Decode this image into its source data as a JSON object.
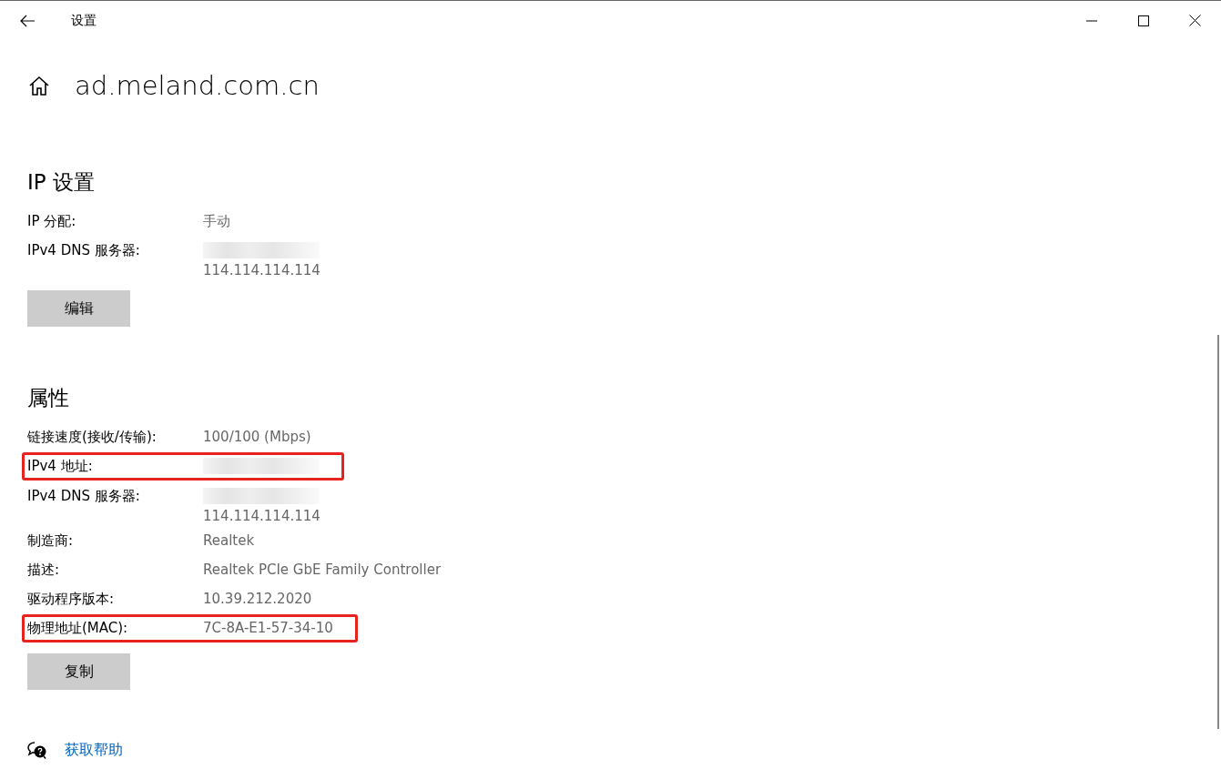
{
  "window": {
    "title": "设置"
  },
  "page_title": "ad.meland.com.cn",
  "sections": [
    {
      "title": "IP 设置",
      "rows": [
        {
          "label": "IP 分配:",
          "highlighted": false,
          "values": [
            {
              "kind": "text",
              "text": "手动"
            }
          ]
        },
        {
          "label": "IPv4 DNS 服务器:",
          "highlighted": false,
          "values": [
            {
              "kind": "redacted"
            },
            {
              "kind": "text",
              "text": "114.114.114.114"
            }
          ]
        }
      ],
      "button": "编辑"
    },
    {
      "title": "属性",
      "rows": [
        {
          "label": "链接速度(接收/传输):",
          "highlighted": false,
          "values": [
            {
              "kind": "text",
              "text": "100/100 (Mbps)"
            }
          ]
        },
        {
          "label": "IPv4 地址:",
          "highlighted": true,
          "values": [
            {
              "kind": "redacted"
            }
          ]
        },
        {
          "label": "IPv4 DNS 服务器:",
          "highlighted": false,
          "values": [
            {
              "kind": "redacted"
            },
            {
              "kind": "text",
              "text": "114.114.114.114"
            }
          ]
        },
        {
          "label": "制造商:",
          "highlighted": false,
          "values": [
            {
              "kind": "text",
              "text": "Realtek"
            }
          ]
        },
        {
          "label": "描述:",
          "highlighted": false,
          "values": [
            {
              "kind": "text",
              "text": "Realtek PCIe GbE Family Controller"
            }
          ]
        },
        {
          "label": "驱动程序版本:",
          "highlighted": false,
          "values": [
            {
              "kind": "text",
              "text": "10.39.212.2020"
            }
          ]
        },
        {
          "label": "物理地址(MAC):",
          "highlighted": true,
          "values": [
            {
              "kind": "text",
              "text": "7C-8A-E1-57-34-10"
            }
          ]
        }
      ],
      "button": "复制"
    }
  ],
  "help_link": "获取帮助"
}
